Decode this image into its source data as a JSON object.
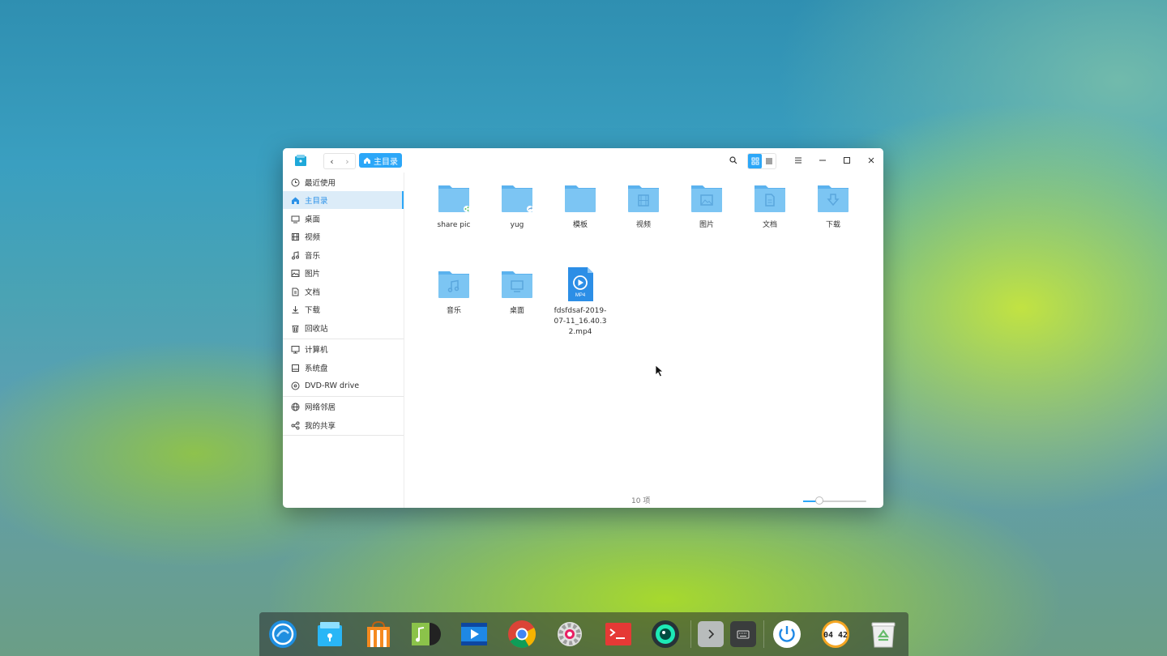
{
  "window": {
    "breadcrumb": "主目录",
    "controls": {
      "search_icon": "search-icon",
      "icon_view_icon": "grid-view-icon",
      "list_view_icon": "list-view-icon",
      "menu_icon": "hamburger-menu-icon",
      "minimize_icon": "minimize-icon",
      "maximize_icon": "maximize-icon",
      "close_icon": "close-icon"
    }
  },
  "sidebar": {
    "items": [
      {
        "label": "最近使用",
        "icon": "clock-icon"
      },
      {
        "label": "主目录",
        "icon": "home-icon",
        "active": true
      },
      {
        "label": "桌面",
        "icon": "desktop-icon"
      },
      {
        "label": "视频",
        "icon": "video-icon"
      },
      {
        "label": "音乐",
        "icon": "music-icon"
      },
      {
        "label": "图片",
        "icon": "picture-icon"
      },
      {
        "label": "文档",
        "icon": "document-icon"
      },
      {
        "label": "下载",
        "icon": "download-icon"
      },
      {
        "label": "回收站",
        "icon": "trash-icon"
      },
      {
        "label": "计算机",
        "icon": "computer-icon"
      },
      {
        "label": "系统盘",
        "icon": "disk-icon"
      },
      {
        "label": "DVD-RW drive",
        "icon": "optical-drive-icon"
      },
      {
        "label": "网络邻居",
        "icon": "network-icon"
      },
      {
        "label": "我的共享",
        "icon": "share-icon"
      }
    ]
  },
  "files": [
    {
      "name": "share pic",
      "type": "folder",
      "emblem": "share"
    },
    {
      "name": "yug",
      "type": "folder",
      "emblem": "link"
    },
    {
      "name": "模板",
      "type": "folder",
      "emblem": "none"
    },
    {
      "name": "视频",
      "type": "folder",
      "emblem": "video"
    },
    {
      "name": "图片",
      "type": "folder",
      "emblem": "picture"
    },
    {
      "name": "文档",
      "type": "folder",
      "emblem": "document"
    },
    {
      "name": "下载",
      "type": "folder",
      "emblem": "download"
    },
    {
      "name": "音乐",
      "type": "folder",
      "emblem": "music"
    },
    {
      "name": "桌面",
      "type": "folder",
      "emblem": "desktop"
    },
    {
      "name": "fdsfdsaf-2019-07-11_16.40.32.mp4",
      "type": "video-file",
      "badge": "MP4"
    }
  ],
  "status": {
    "item_count": "10 项",
    "zoom_fraction": 0.25
  },
  "dock": {
    "apps": [
      "launcher-icon",
      "file-manager-icon",
      "app-store-icon",
      "music-player-icon",
      "movie-player-icon",
      "chrome-icon",
      "settings-icon",
      "terminal-icon",
      "camera-icon",
      "show-more-icon",
      "keyboard-icon",
      "power-icon",
      "clock-icon",
      "trash-icon"
    ],
    "clock_text": "04 42"
  },
  "colors": {
    "accent": "#2ca7f8",
    "folder": "#7cc5f3",
    "folder_tab": "#5bb2ee"
  }
}
